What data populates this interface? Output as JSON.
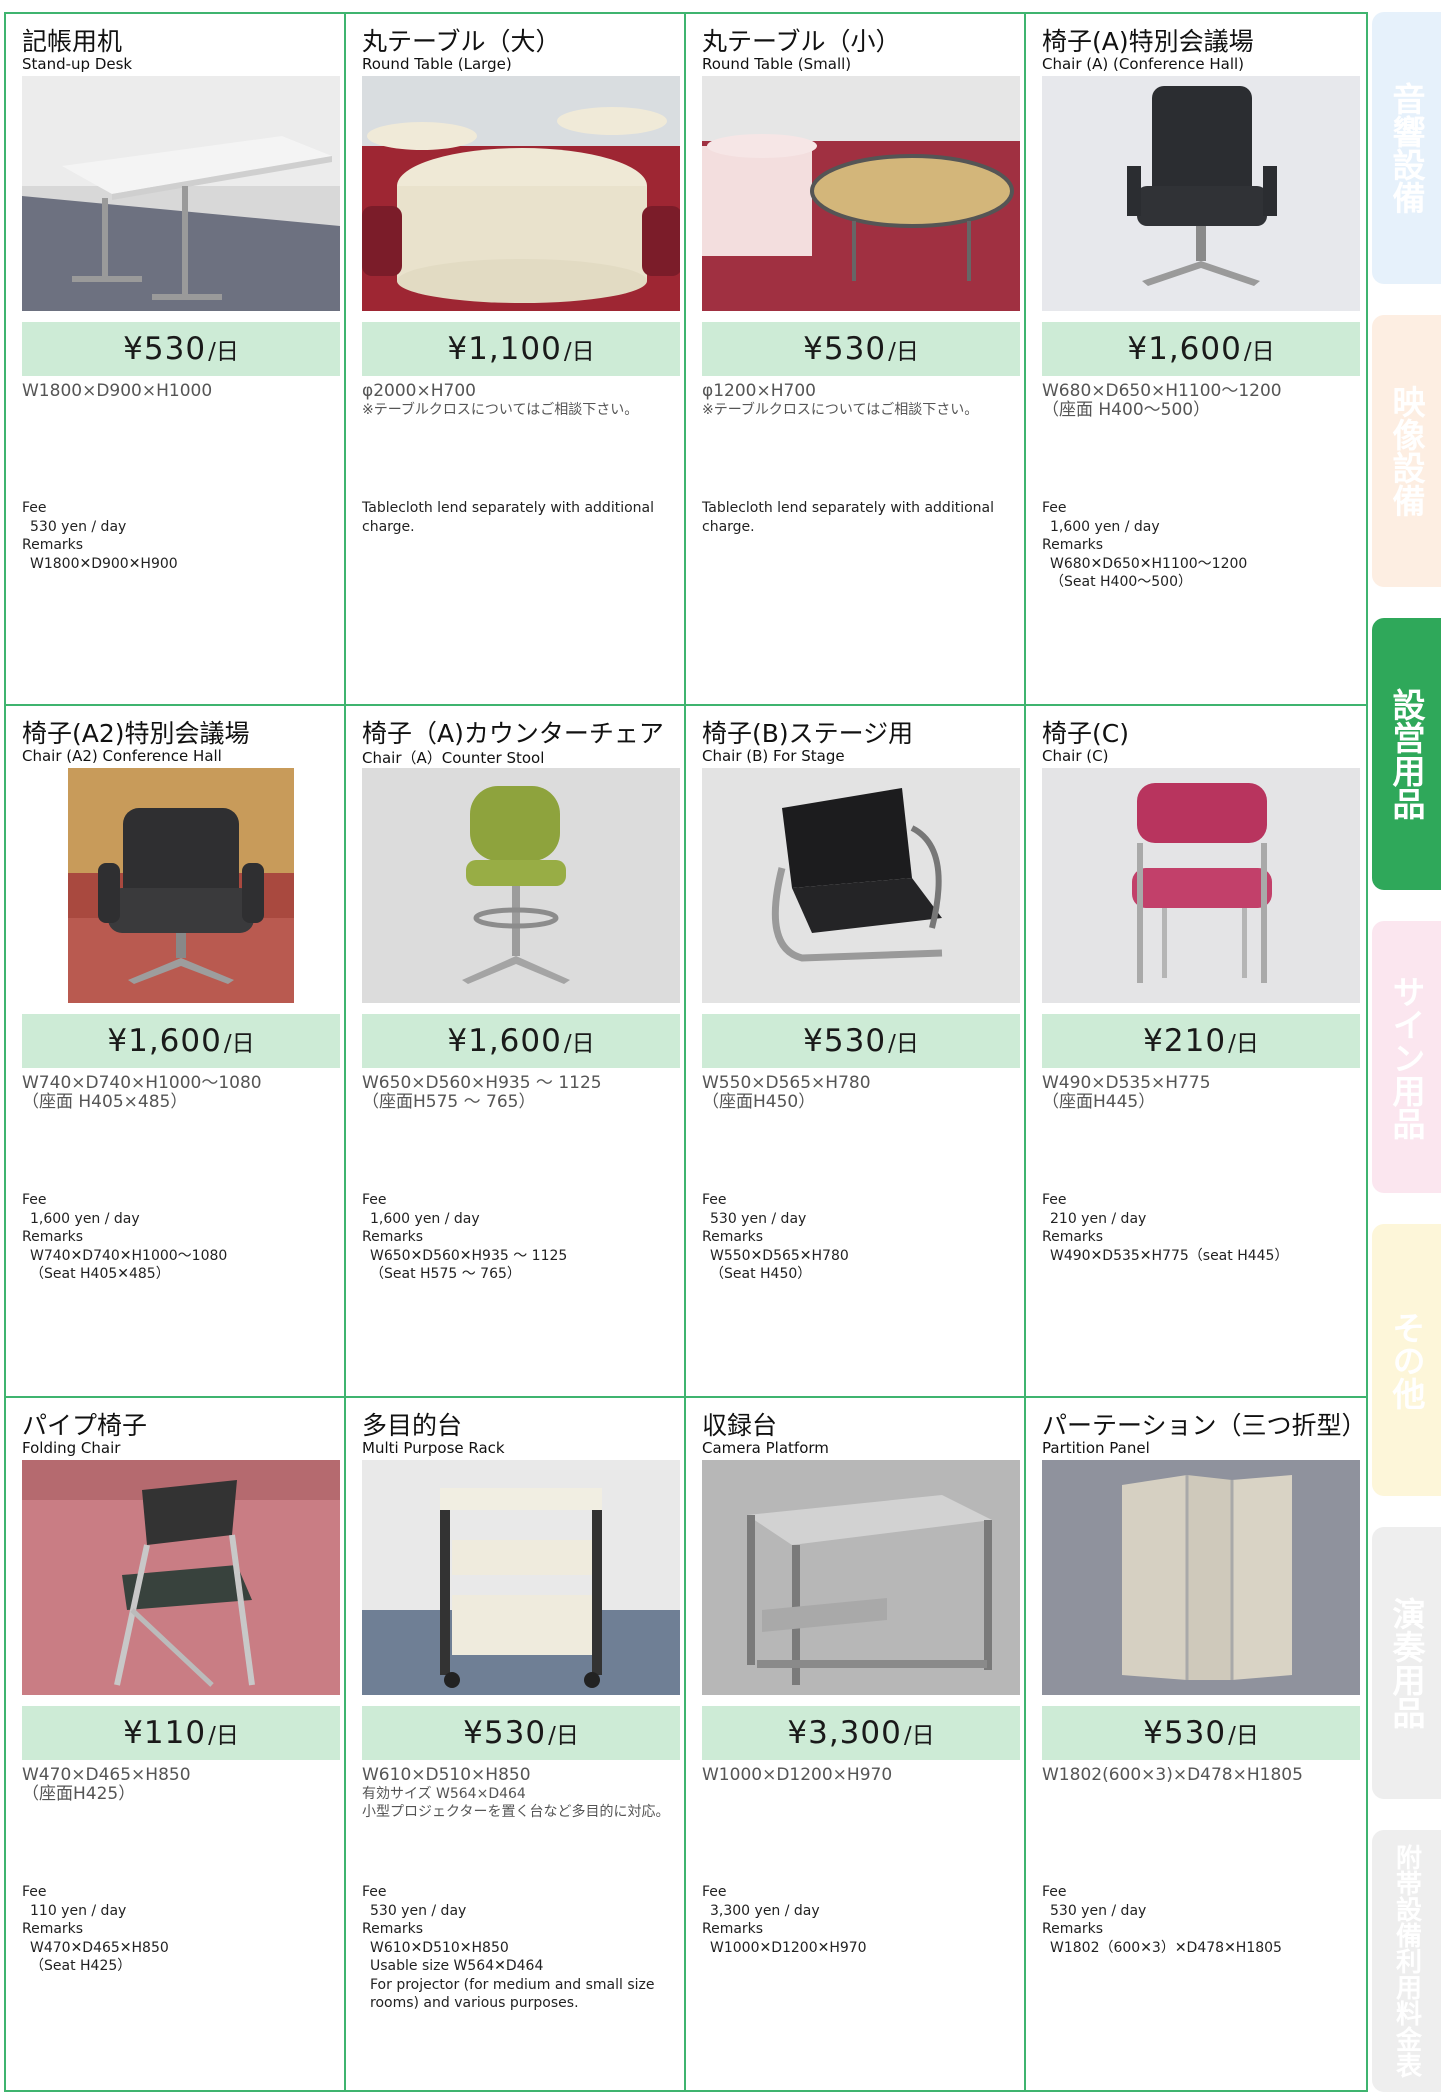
{
  "items": [
    {
      "jp": "記帳用机",
      "en": "Stand-up Desk",
      "amount": "¥530",
      "unit": "/日",
      "spec": [
        "W1800×D900×H1000"
      ],
      "eng": [
        {
          "t": "Fee",
          "i": false
        },
        {
          "t": "530 yen / day",
          "i": true
        },
        {
          "t": "Remarks",
          "i": false
        },
        {
          "t": "W1800✕D900✕H900",
          "i": true
        }
      ]
    },
    {
      "jp": "丸テーブル（大）",
      "en": "Round Table (Large)",
      "amount": "¥1,100",
      "unit": "/日",
      "spec": [
        "φ2000×H700",
        "※テーブルクロスについてはご相談下さい。"
      ],
      "eng": [
        {
          "t": "Tablecloth lend separately with additional",
          "i": false
        },
        {
          "t": "charge.",
          "i": false
        }
      ]
    },
    {
      "jp": "丸テーブル（小）",
      "en": "Round Table (Small)",
      "amount": "¥530",
      "unit": "/日",
      "spec": [
        "φ1200×H700",
        "※テーブルクロスについてはご相談下さい。"
      ],
      "eng": [
        {
          "t": "Tablecloth lend separately with additional",
          "i": false
        },
        {
          "t": "charge.",
          "i": false
        }
      ]
    },
    {
      "jp": "椅子(A)特別会議場",
      "en": "Chair (A) (Conference Hall)",
      "amount": "¥1,600",
      "unit": "/日",
      "spec": [
        "W680×D650×H1100～1200",
        "（座面 H400～500）"
      ],
      "eng": [
        {
          "t": "Fee",
          "i": false
        },
        {
          "t": "1,600 yen / day",
          "i": true
        },
        {
          "t": "Remarks",
          "i": false
        },
        {
          "t": "W680✕D650✕H1100～1200",
          "i": true
        },
        {
          "t": "（Seat H400～500）",
          "i": true
        }
      ]
    },
    {
      "jp": "椅子(A2)特別会議場",
      "en": "Chair (A2) Conference Hall",
      "amount": "¥1,600",
      "unit": "/日",
      "spec": [
        "W740×D740×H1000～1080",
        "（座面 H405×485）"
      ],
      "eng": [
        {
          "t": "Fee",
          "i": false
        },
        {
          "t": "1,600 yen / day",
          "i": true
        },
        {
          "t": "Remarks",
          "i": false
        },
        {
          "t": "W740✕D740✕H1000～1080",
          "i": true
        },
        {
          "t": "（Seat H405✕485）",
          "i": true
        }
      ]
    },
    {
      "jp": "椅子（A)カウンターチェア",
      "en": "Chair（A）Counter Stool",
      "amount": "¥1,600",
      "unit": "/日",
      "spec": [
        "W650×D560×H935 ～ 1125",
        "（座面H575 ～ 765）"
      ],
      "eng": [
        {
          "t": "Fee",
          "i": false
        },
        {
          "t": "1,600 yen / day",
          "i": true
        },
        {
          "t": "Remarks",
          "i": false
        },
        {
          "t": "W650✕D560✕H935 ～ 1125",
          "i": true
        },
        {
          "t": "（Seat H575 ～ 765）",
          "i": true
        }
      ]
    },
    {
      "jp": "椅子(B)ステージ用",
      "en": "Chair (B) For Stage",
      "amount": "¥530",
      "unit": "/日",
      "spec": [
        "W550×D565×H780",
        "（座面H450）"
      ],
      "eng": [
        {
          "t": "Fee",
          "i": false
        },
        {
          "t": "530 yen / day",
          "i": true
        },
        {
          "t": "Remarks",
          "i": false
        },
        {
          "t": "W550✕D565✕H780",
          "i": true
        },
        {
          "t": "（Seat H450）",
          "i": true
        }
      ]
    },
    {
      "jp": "椅子(C)",
      "en": "Chair (C)",
      "amount": "¥210",
      "unit": "/日",
      "spec": [
        "W490×D535×H775",
        "（座面H445）"
      ],
      "eng": [
        {
          "t": "Fee",
          "i": false
        },
        {
          "t": "210 yen / day",
          "i": true
        },
        {
          "t": "Remarks",
          "i": false
        },
        {
          "t": "W490✕D535✕H775（seat H445）",
          "i": true
        }
      ]
    },
    {
      "jp": "パイプ椅子",
      "en": "Folding Chair",
      "amount": "¥110",
      "unit": "/日",
      "spec": [
        "W470×D465×H850",
        "（座面H425）"
      ],
      "eng": [
        {
          "t": "Fee",
          "i": false
        },
        {
          "t": "110 yen / day",
          "i": true
        },
        {
          "t": "Remarks",
          "i": false
        },
        {
          "t": "W470✕D465✕H850",
          "i": true
        },
        {
          "t": "（Seat H425）",
          "i": true
        }
      ]
    },
    {
      "jp": "多目的台",
      "en": "Multi Purpose Rack",
      "amount": "¥530",
      "unit": "/日",
      "spec": [
        "W610×D510×H850",
        "有効サイズ W564×D464",
        "小型プロジェクターを置く台など多目的に対応。"
      ],
      "eng": [
        {
          "t": "Fee",
          "i": false
        },
        {
          "t": "530 yen / day",
          "i": true
        },
        {
          "t": "Remarks",
          "i": false
        },
        {
          "t": "W610✕D510✕H850",
          "i": true
        },
        {
          "t": "Usable size W564✕D464",
          "i": true
        },
        {
          "t": "For projector (for medium and small size",
          "i": true
        },
        {
          "t": "rooms) and various purposes.",
          "i": true
        }
      ]
    },
    {
      "jp": "収録台",
      "en": "Camera Platform",
      "amount": "¥3,300",
      "unit": "/日",
      "spec": [
        "W1000×D1200×H970"
      ],
      "eng": [
        {
          "t": "Fee",
          "i": false
        },
        {
          "t": "3,300 yen / day",
          "i": true
        },
        {
          "t": "Remarks",
          "i": false
        },
        {
          "t": "W1000✕D1200✕H970",
          "i": true
        }
      ]
    },
    {
      "jp": "パーテーション（三つ折型）",
      "en": "Partition Panel",
      "amount": "¥530",
      "unit": "/日",
      "spec": [
        "W1802(600×3)×D478×H1805"
      ],
      "eng": [
        {
          "t": "Fee",
          "i": false
        },
        {
          "t": "530 yen / day",
          "i": true
        },
        {
          "t": "Remarks",
          "i": false
        },
        {
          "t": "W1802（600✕3）✕D478✕H1805",
          "i": true
        }
      ]
    }
  ],
  "tabs": [
    {
      "label": "音響設備",
      "color": "#e6f1fb",
      "active": false
    },
    {
      "label": "映像設備",
      "color": "#fdeee2",
      "active": false
    },
    {
      "label": "設営用品",
      "color": "#2fa85a",
      "active": true
    },
    {
      "label": "サイン用品",
      "color": "#fbe6ef",
      "active": false
    },
    {
      "label": "その他",
      "color": "#fdf6d9",
      "active": false
    },
    {
      "label": "演奏用品",
      "color": "#eeeeee",
      "active": false
    },
    {
      "label": "附帯設備利用料金表",
      "color": "#eeeeee",
      "active": false
    }
  ]
}
